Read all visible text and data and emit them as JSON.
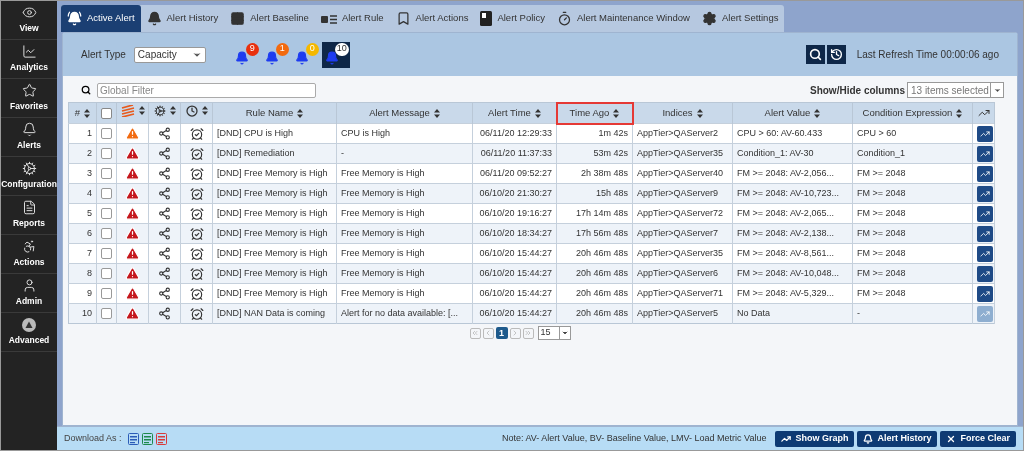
{
  "sidebar": {
    "items": [
      {
        "label": "View",
        "selected": false
      },
      {
        "label": "Analytics",
        "selected": false
      },
      {
        "label": "Favorites",
        "selected": false
      },
      {
        "label": "Alerts",
        "selected": false
      },
      {
        "label": "Configuration",
        "selected": false
      },
      {
        "label": "Reports",
        "selected": false
      },
      {
        "label": "Actions",
        "selected": false
      },
      {
        "label": "Admin",
        "selected": false
      },
      {
        "label": "Advanced",
        "selected": false
      }
    ]
  },
  "tabs": [
    {
      "label": "Active Alert",
      "selected": true
    },
    {
      "label": "Alert History",
      "selected": false
    },
    {
      "label": "Alert Baseline",
      "selected": false
    },
    {
      "label": "Alert Rule",
      "selected": false
    },
    {
      "label": "Alert Actions",
      "selected": false
    },
    {
      "label": "Alert Policy",
      "selected": false
    },
    {
      "label": "Alert Maintenance Window",
      "selected": false
    },
    {
      "label": "Alert Settings",
      "selected": false
    }
  ],
  "filter_bar": {
    "alert_type_label": "Alert Type",
    "alert_type_value": "Capacity",
    "severity_counts": [
      {
        "count": "9",
        "color": "#e8300e",
        "selected": false
      },
      {
        "count": "1",
        "color": "#f26a0f",
        "selected": false
      },
      {
        "count": "0",
        "color": "#f5b800",
        "selected": false
      },
      {
        "count": "10",
        "color": "#ffffff",
        "selected": true
      }
    ],
    "last_refresh": "Last Refresh Time 00:00:06 ago"
  },
  "table_toolbar": {
    "global_filter_placeholder": "Global Filter",
    "columns_label": "Show/Hide columns",
    "columns_value": "13 items selected"
  },
  "table": {
    "columns": [
      {
        "kind": "text",
        "label": "#",
        "highlighted": false
      },
      {
        "kind": "checkbox",
        "checked": false
      },
      {
        "kind": "severity"
      },
      {
        "kind": "cogs"
      },
      {
        "kind": "clock"
      },
      {
        "kind": "text",
        "label": "Rule Name",
        "highlighted": false
      },
      {
        "kind": "text",
        "label": "Alert Message",
        "highlighted": false
      },
      {
        "kind": "text",
        "label": "Alert Time",
        "highlighted": false
      },
      {
        "kind": "text",
        "label": "Time Ago",
        "highlighted": true
      },
      {
        "kind": "text",
        "label": "Indices",
        "highlighted": false
      },
      {
        "kind": "text",
        "label": "Alert Value",
        "highlighted": false
      },
      {
        "kind": "text",
        "label": "Condition Expression",
        "highlighted": false
      },
      {
        "kind": "graph"
      }
    ],
    "rows": [
      {
        "index": "1",
        "checked": false,
        "kind": "major",
        "rule": "[DND] CPU is High",
        "message": "CPU is High",
        "time": "06/11/20 12:29:33",
        "ago": "1m 42s",
        "indices": "AppTier>QAServer2",
        "value": "CPU > 60: AV-60.433",
        "condition": "CPU > 60",
        "graph_disabled": false
      },
      {
        "index": "2",
        "checked": false,
        "kind": "critical",
        "rule": "[DND] Remediation",
        "message": "-",
        "time": "06/11/20 11:37:33",
        "ago": "53m 42s",
        "indices": "AppTier>QAServer35",
        "value": "Condition_1: AV-30",
        "condition": "Condition_1",
        "graph_disabled": false
      },
      {
        "index": "3",
        "checked": false,
        "kind": "critical",
        "rule": "[DND] Free Memory is High",
        "message": "Free Memory is High",
        "time": "06/11/20 09:52:27",
        "ago": "2h 38m 48s",
        "indices": "AppTier>QAServer40",
        "value": "FM >= 2048: AV-2,056...",
        "condition": "FM >= 2048",
        "graph_disabled": false
      },
      {
        "index": "4",
        "checked": false,
        "kind": "critical",
        "rule": "[DND] Free Memory is High",
        "message": "Free Memory is High",
        "time": "06/10/20 21:30:27",
        "ago": "15h 48s",
        "indices": "AppTier>QAServer9",
        "value": "FM >= 2048: AV-10,723...",
        "condition": "FM >= 2048",
        "graph_disabled": false
      },
      {
        "index": "5",
        "checked": false,
        "kind": "critical",
        "rule": "[DND] Free Memory is High",
        "message": "Free Memory is High",
        "time": "06/10/20 19:16:27",
        "ago": "17h 14m 48s",
        "indices": "AppTier>QAServer72",
        "value": "FM >= 2048: AV-2,065...",
        "condition": "FM >= 2048",
        "graph_disabled": false
      },
      {
        "index": "6",
        "checked": false,
        "kind": "critical",
        "rule": "[DND] Free Memory is High",
        "message": "Free Memory is High",
        "time": "06/10/20 18:34:27",
        "ago": "17h 56m 48s",
        "indices": "AppTier>QAServer7",
        "value": "FM >= 2048: AV-2,138...",
        "condition": "FM >= 2048",
        "graph_disabled": false
      },
      {
        "index": "7",
        "checked": false,
        "kind": "critical",
        "rule": "[DND] Free Memory is High",
        "message": "Free Memory is High",
        "time": "06/10/20 15:44:27",
        "ago": "20h 46m 48s",
        "indices": "AppTier>QAServer35",
        "value": "FM >= 2048: AV-8,561...",
        "condition": "FM >= 2048",
        "graph_disabled": false
      },
      {
        "index": "8",
        "checked": false,
        "kind": "critical",
        "rule": "[DND] Free Memory is High",
        "message": "Free Memory is High",
        "time": "06/10/20 15:44:27",
        "ago": "20h 46m 48s",
        "indices": "AppTier>QAServer6",
        "value": "FM >= 2048: AV-10,048...",
        "condition": "FM >= 2048",
        "graph_disabled": false
      },
      {
        "index": "9",
        "checked": false,
        "kind": "critical",
        "rule": "[DND] Free Memory is High",
        "message": "Free Memory is High",
        "time": "06/10/20 15:44:27",
        "ago": "20h 46m 48s",
        "indices": "AppTier>QAServer71",
        "value": "FM >= 2048: AV-5,329...",
        "condition": "FM >= 2048",
        "graph_disabled": false
      },
      {
        "index": "10",
        "checked": false,
        "kind": "critical",
        "rule": "[DND] NAN Data is coming",
        "message": "Alert for no data available: [...",
        "time": "06/10/20 15:44:27",
        "ago": "20h 46m 48s",
        "indices": "AppTier>QAServer5",
        "value": "No Data",
        "condition": "-",
        "graph_disabled": true
      }
    ]
  },
  "pagination": {
    "pages": [
      {
        "label": "1",
        "selected": true
      }
    ],
    "page_size": "15"
  },
  "footer": {
    "download_label": "Download As :",
    "downloads": [
      {
        "kind": "word"
      },
      {
        "kind": "excel"
      },
      {
        "kind": "pdf"
      }
    ],
    "note": "Note: AV- Alert Value, BV- Baseline Value, LMV- Load Metric Value",
    "buttons": [
      {
        "label": "Show Graph"
      },
      {
        "label": "Alert History"
      },
      {
        "label": "Force Clear"
      }
    ]
  }
}
